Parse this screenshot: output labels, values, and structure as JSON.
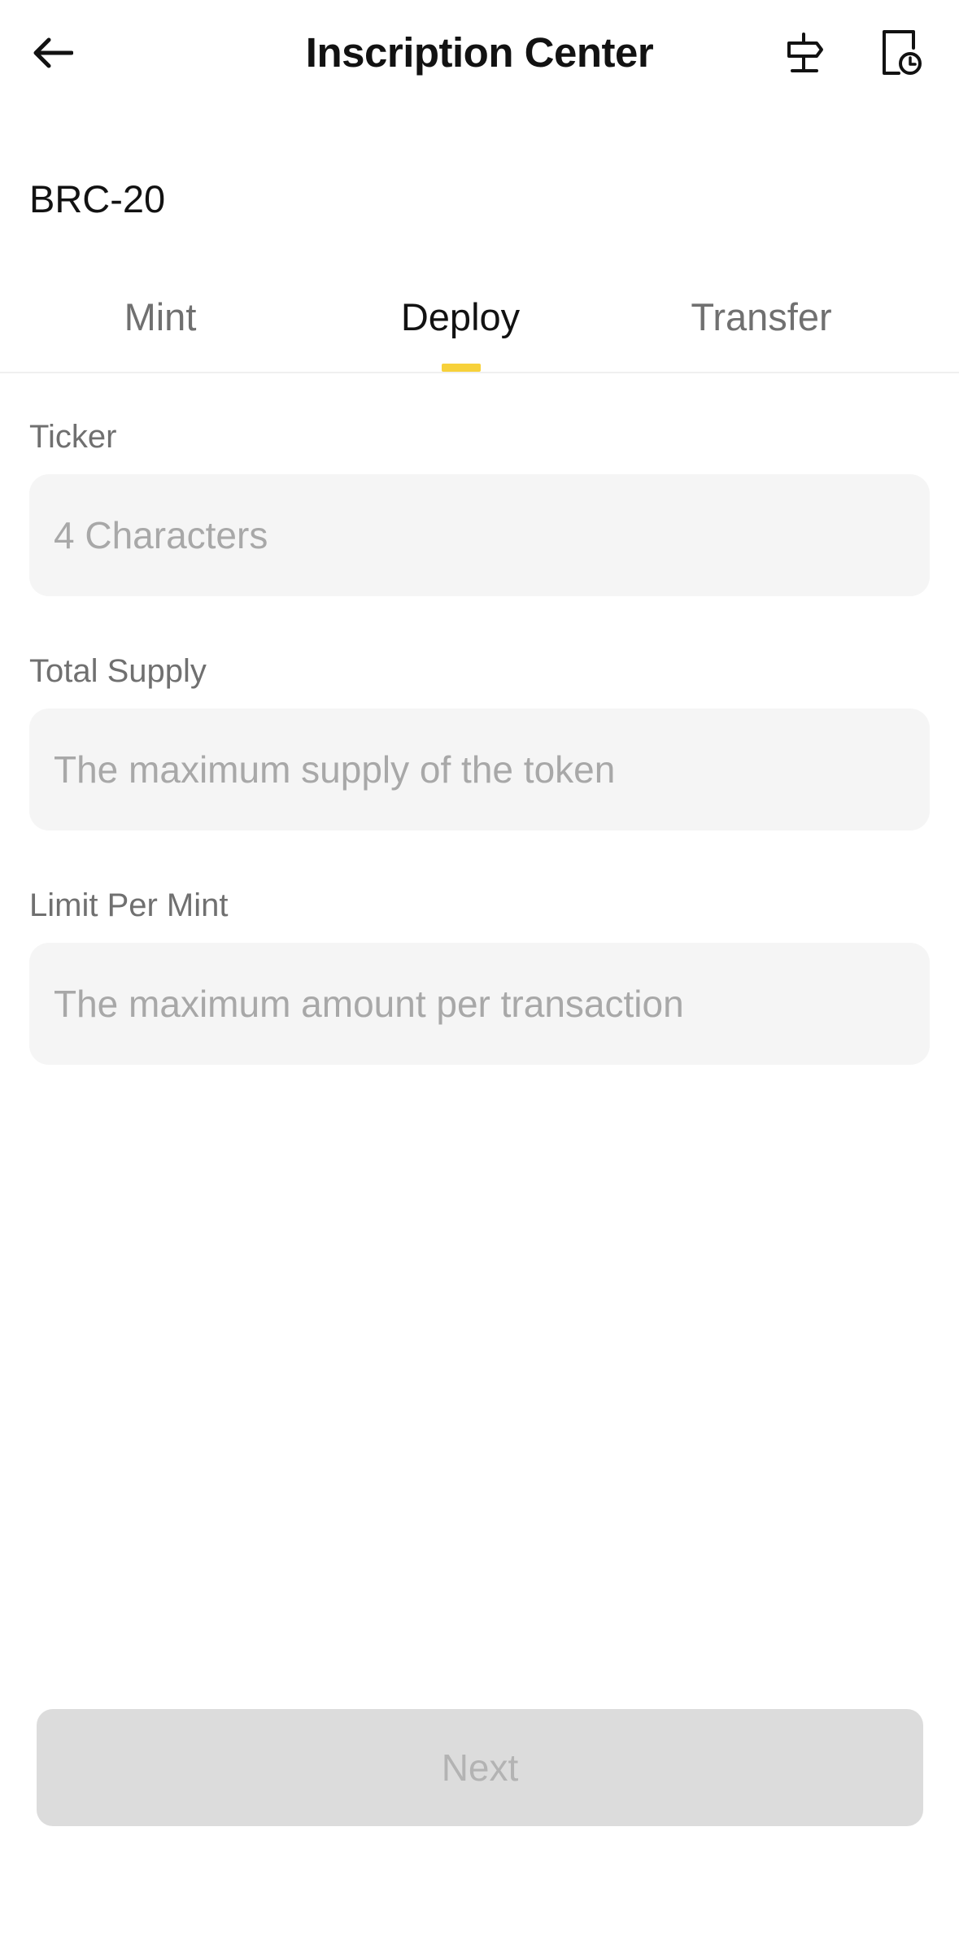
{
  "header": {
    "title": "Inscription Center",
    "back_icon": "arrow-left-icon",
    "signpost_icon": "signpost-icon",
    "history_icon": "document-clock-icon"
  },
  "section": {
    "title": "BRC-20"
  },
  "tabs": [
    {
      "label": "Mint",
      "active": false
    },
    {
      "label": "Deploy",
      "active": true
    },
    {
      "label": "Transfer",
      "active": false
    }
  ],
  "form": {
    "ticker": {
      "label": "Ticker",
      "value": "",
      "placeholder": "4 Characters"
    },
    "total_supply": {
      "label": "Total Supply",
      "value": "",
      "placeholder": "The maximum supply of the token"
    },
    "limit_per_mint": {
      "label": "Limit Per Mint",
      "value": "",
      "placeholder": "The maximum amount per transaction"
    }
  },
  "footer": {
    "next_label": "Next",
    "next_enabled": false
  },
  "colors": {
    "accent": "#f7d13a",
    "input_bg": "#f5f5f5",
    "disabled_button_bg": "#dcdcdc",
    "disabled_button_text": "#b3b3b3"
  }
}
